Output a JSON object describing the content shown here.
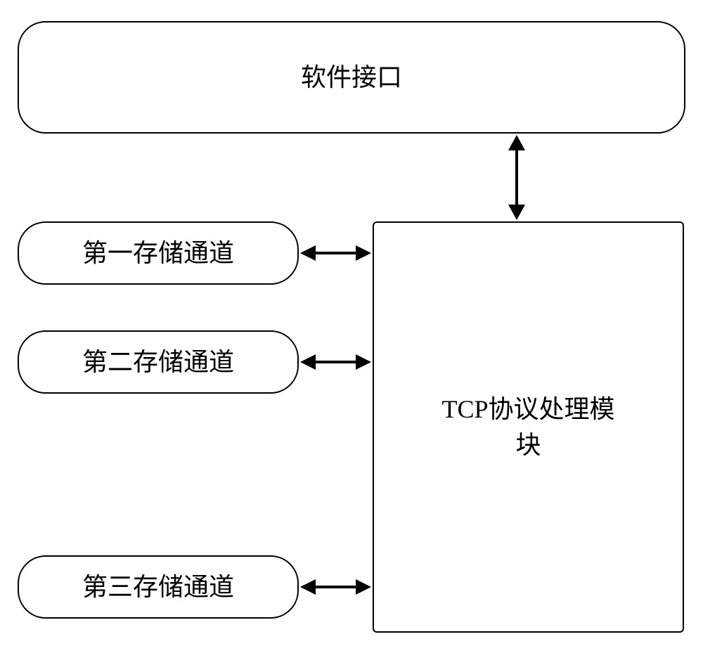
{
  "top_box": {
    "label": "软件接口"
  },
  "channels": [
    {
      "label": "第一存储通道"
    },
    {
      "label": "第二存储通道"
    },
    {
      "label": "第三存储通道"
    }
  ],
  "tcp_box": {
    "label": "TCP协议处理模块"
  }
}
